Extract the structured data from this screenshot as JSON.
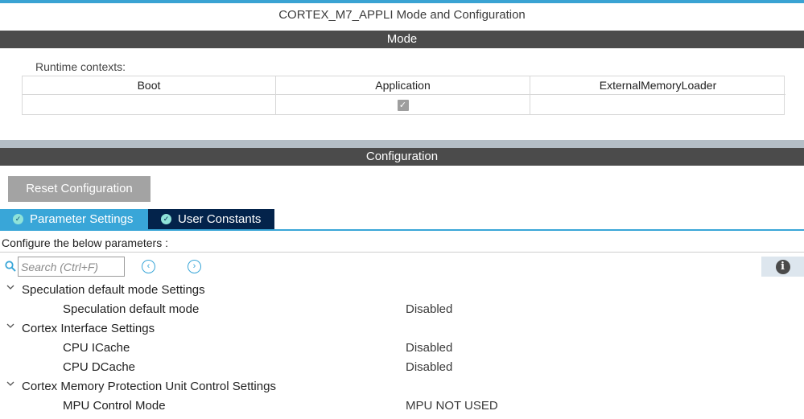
{
  "window": {
    "title": "CORTEX_M7_APPLI Mode and Configuration"
  },
  "mode": {
    "header": "Mode",
    "runtime_label": "Runtime contexts:",
    "columns": [
      "Boot",
      "Application",
      "ExternalMemoryLoader"
    ],
    "checked": [
      false,
      true,
      false
    ]
  },
  "configuration": {
    "header": "Configuration",
    "reset_label": "Reset Configuration",
    "tabs": [
      {
        "label": "Parameter Settings",
        "active": true
      },
      {
        "label": "User Constants",
        "active": false
      }
    ],
    "configure_text": "Configure the below parameters :",
    "search_placeholder": "Search (Ctrl+F)",
    "icons": {
      "search": "search-icon",
      "prev": "chevron-left-circle-icon",
      "next": "chevron-right-circle-icon",
      "info": "info-icon",
      "expand": "chevron-down-icon",
      "tab_check": "check-circle-icon"
    }
  },
  "tree": [
    {
      "type": "group",
      "label": "Speculation default mode Settings"
    },
    {
      "type": "param",
      "label": "Speculation default mode",
      "value": "Disabled"
    },
    {
      "type": "group",
      "label": "Cortex Interface Settings"
    },
    {
      "type": "param",
      "label": "CPU ICache",
      "value": "Disabled"
    },
    {
      "type": "param",
      "label": "CPU DCache",
      "value": "Disabled"
    },
    {
      "type": "group",
      "label": "Cortex Memory Protection Unit Control Settings"
    },
    {
      "type": "param",
      "label": "MPU Control Mode",
      "value": "MPU NOT USED"
    }
  ],
  "colors": {
    "accent": "#39a6d8",
    "tab_inactive": "#03234b",
    "section_bar": "#4b4b4b",
    "reset_button": "#a3a3a3"
  }
}
